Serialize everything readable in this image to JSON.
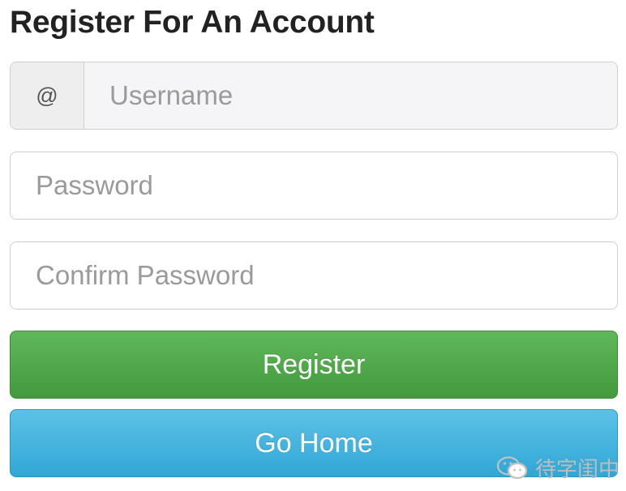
{
  "page": {
    "title": "Register For An Account"
  },
  "form": {
    "username": {
      "addon": "@",
      "placeholder": "Username",
      "value": ""
    },
    "password": {
      "placeholder": "Password",
      "value": ""
    },
    "confirm_password": {
      "placeholder": "Confirm Password",
      "value": ""
    },
    "register_label": "Register",
    "home_label": "Go Home"
  },
  "watermark": {
    "icon": "wechat-icon",
    "text": "待字闺中"
  },
  "colors": {
    "register_button": "#4cae4c",
    "home_button": "#46b8da",
    "title_text": "#222222"
  }
}
